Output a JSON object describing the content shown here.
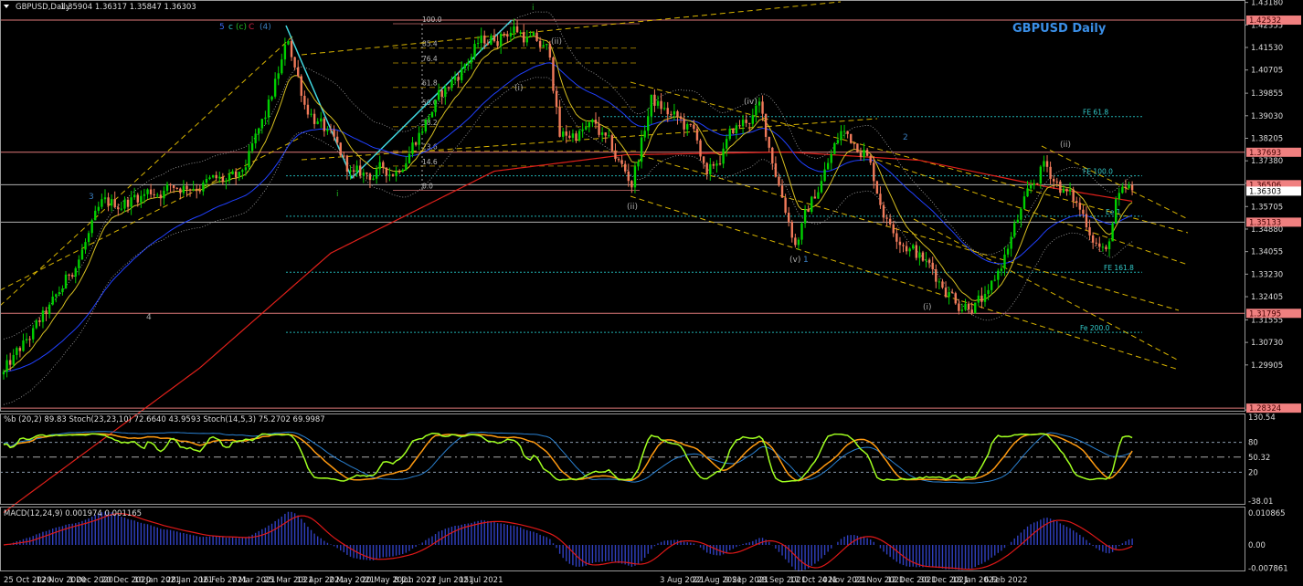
{
  "header": {
    "symbol": "GBPUSD,Daily",
    "ohlc": "1.35904 1.36317 1.35847 1.36303"
  },
  "title": "GBPUSD Daily",
  "wave_labels": [
    {
      "text": "5",
      "color": "#3a6cff"
    },
    {
      "text": "c",
      "color": "#33cccc"
    },
    {
      "text": "(c)",
      "color": "#22bb22"
    },
    {
      "text": "C",
      "color": "#cc2244"
    },
    {
      "text": "(4)",
      "color": "#3a7fc0"
    },
    {
      "text": "3",
      "color": "#3a7fc0"
    },
    {
      "text": "4",
      "color": "#aaaaaa"
    },
    {
      "text": "i",
      "color": "#22bb22"
    },
    {
      "text": "i",
      "color": "#22bb22"
    },
    {
      "text": "(ii)",
      "color": "#aaaaaa"
    },
    {
      "text": "(i)",
      "color": "#aaaaaa"
    },
    {
      "text": "(ii)",
      "color": "#aaaaaa"
    },
    {
      "text": "(iv)",
      "color": "#aaaaaa"
    },
    {
      "text": "2",
      "color": "#3a7fc0"
    },
    {
      "text": "(v)",
      "color": "#aaaaaa"
    },
    {
      "text": "1",
      "color": "#3a7fc0"
    },
    {
      "text": "(i)",
      "color": "#aaaaaa"
    },
    {
      "text": "(ii)",
      "color": "#aaaaaa"
    }
  ],
  "fib_retracement_labels": [
    "100.0",
    "85.4",
    "76.4",
    "61.8",
    "50.0",
    "38.2",
    "23.6",
    "14.6",
    "0.0"
  ],
  "fib_expansion_labels": [
    "FE 61.8",
    "FE 100.0",
    "Ee 1",
    "FE 161.8",
    "Fe 200.0"
  ],
  "price_axis": [
    "1.43180",
    "1.42355",
    "1.41530",
    "1.40705",
    "1.39855",
    "1.39030",
    "1.38205",
    "1.37380",
    "1.36555",
    "1.35705",
    "1.34880",
    "1.34055",
    "1.33230",
    "1.32405",
    "1.31555",
    "1.30730",
    "1.29905",
    "1.28255"
  ],
  "level_labels": [
    "1.42532",
    "1.37693",
    "1.36506",
    "1.35133",
    "1.31795",
    "1.28324"
  ],
  "current_price": "1.36303",
  "stoch_panel": {
    "label": "%b (20,2) 89.83  Stoch(23,23,10) 72.6640 43.9593  Stoch(14,5,3) 75.2702 69.9987",
    "axis": [
      "130.54",
      "80",
      "50.32",
      "20",
      "-38.01"
    ]
  },
  "macd_panel": {
    "label": "MACD(12,24,9) 0.001974 0.001165",
    "axis": [
      "0.010865",
      "0.00",
      "-0.007861"
    ]
  },
  "date_axis": [
    "25 Oct 2020",
    "12 Nov 2020",
    "1 Dec 2020",
    "20 Dec 2020",
    "10 Jan 2021",
    "28 Jan 2021",
    "16 Feb 2021",
    "7 Mar 2021",
    "25 Mar 2021",
    "13 Apr 2021",
    "2 May 2021",
    "20 May 2021",
    "8 Jun 2021",
    "27 Jun 2021",
    "15 Jul 2021",
    "3 Aug 2021",
    "22 Aug 2021",
    "9 Sep 2021",
    "28 Sep 2021",
    "17 Oct 2021",
    "4 Nov 2021",
    "23 Nov 2021",
    "12 Dec 2021",
    "30 Dec 2021",
    "18 Jan 2022",
    "6 Feb 2022"
  ],
  "colors": {
    "up": "#00d000",
    "down": "#f07a5a",
    "ma_long": "#e0201a",
    "ma_mid": "#2040ff",
    "ma_fast": "#d8c020",
    "level": "#e07a7a",
    "fib_cyan": "#20b0b0",
    "channel": "#d8b400",
    "title": "#3a8ee6"
  },
  "chart_data": {
    "type": "candlestick",
    "title": "GBPUSD Daily",
    "ylim": [
      1.2825,
      1.4318
    ],
    "close_path": [
      [
        0,
        1.2956
      ],
      [
        16,
        1.3224
      ],
      [
        30,
        1.3558
      ],
      [
        44,
        1.3625
      ],
      [
        58,
        1.3658
      ],
      [
        72,
        1.3658
      ],
      [
        80,
        1.3892
      ],
      [
        87,
        1.4176
      ],
      [
        92,
        1.3959
      ],
      [
        107,
        1.3675
      ],
      [
        120,
        1.3708
      ],
      [
        131,
        1.3926
      ],
      [
        145,
        1.416
      ],
      [
        156,
        1.4227
      ],
      [
        167,
        1.4126
      ],
      [
        170,
        1.3825
      ],
      [
        181,
        1.3859
      ],
      [
        192,
        1.3658
      ],
      [
        198,
        1.3959
      ],
      [
        212,
        1.3825
      ],
      [
        215,
        1.3658
      ],
      [
        223,
        1.3842
      ],
      [
        231,
        1.3926
      ],
      [
        242,
        1.3441
      ],
      [
        256,
        1.3842
      ],
      [
        263,
        1.3792
      ],
      [
        270,
        1.3525
      ],
      [
        281,
        1.3374
      ],
      [
        292,
        1.3224
      ],
      [
        301,
        1.3224
      ],
      [
        309,
        1.3491
      ],
      [
        318,
        1.3725
      ],
      [
        329,
        1.3558
      ],
      [
        337,
        1.3391
      ],
      [
        340,
        1.3575
      ],
      [
        345,
        1.363
      ]
    ],
    "ma_long_path": [
      [
        0,
        1.245
      ],
      [
        60,
        1.298
      ],
      [
        100,
        1.34
      ],
      [
        150,
        1.37
      ],
      [
        190,
        1.376
      ],
      [
        240,
        1.377
      ],
      [
        280,
        1.374
      ],
      [
        320,
        1.364
      ],
      [
        345,
        1.359
      ]
    ],
    "levels": [
      1.42532,
      1.37693,
      1.36506,
      1.35133,
      1.31795,
      1.28324
    ],
    "fib_expansion_levels": [
      1.39,
      1.3683,
      1.3535,
      1.333,
      1.311
    ]
  }
}
